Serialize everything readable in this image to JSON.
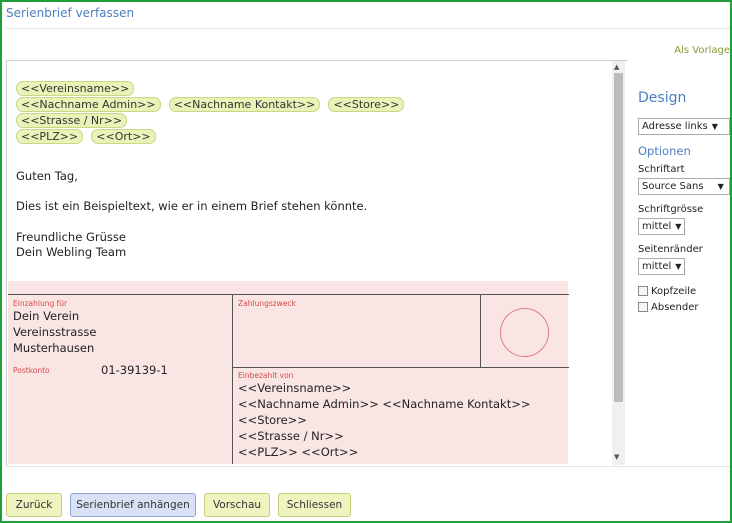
{
  "window": {
    "title": "Serienbrief verfassen",
    "vorlage_link": "Als Vorlage"
  },
  "editor": {
    "tags": [
      [
        "<<Vereinsname>>"
      ],
      [
        "<<Nachname Admin>>",
        "<<Nachname Kontakt>>",
        "<<Store>>"
      ],
      [
        "<<Strasse / Nr>>"
      ],
      [
        "<<PLZ>>",
        "<<Ort>>"
      ]
    ],
    "greeting": "Guten Tag,",
    "body": "Dies ist ein Beispieltext, wie er in einem Brief stehen könnte.",
    "closing1": "Freundliche Grüsse",
    "closing2": "Dein Webling Team"
  },
  "slip": {
    "einzahlung_label": "Einzahlung für",
    "recipient_line1": "Dein Verein",
    "recipient_line2": "Vereinsstrasse",
    "recipient_line3": "Musterhausen",
    "postkonto_label": "Postkonto",
    "postkonto_value": "01-39139-1",
    "zahlungszweck_label": "Zahlungszweck",
    "einbezahlt_label": "Einbezahlt von",
    "payer_line1": "<<Vereinsname>>",
    "payer_line2": "<<Nachname Admin>> <<Nachname Kontakt>> <<Store>>",
    "payer_line3": "<<Strasse / Nr>>",
    "payer_line4": "<<PLZ>> <<Ort>>"
  },
  "sidebar": {
    "design_heading": "Design",
    "design_select": "Adresse links",
    "optionen_heading": "Optionen",
    "schriftart_label": "Schriftart",
    "schriftart_value": "Source Sans",
    "schriftgroesse_label": "Schriftgrösse",
    "schriftgroesse_value": "mittel",
    "seitenraender_label": "Seitenränder",
    "seitenraender_value": "mittel",
    "kopfzeile_label": "Kopfzeile",
    "absender_label": "Absender"
  },
  "buttons": {
    "zurueck": "Zurück",
    "anhaengen": "Serienbrief anhängen",
    "vorschau": "Vorschau",
    "schliessen": "Schliessen"
  },
  "colors": {
    "accent": "#4b7fc2",
    "frame": "#1f9e3a",
    "tag_bg": "#e8f3b8",
    "slip_bg": "#f9e6e4"
  }
}
